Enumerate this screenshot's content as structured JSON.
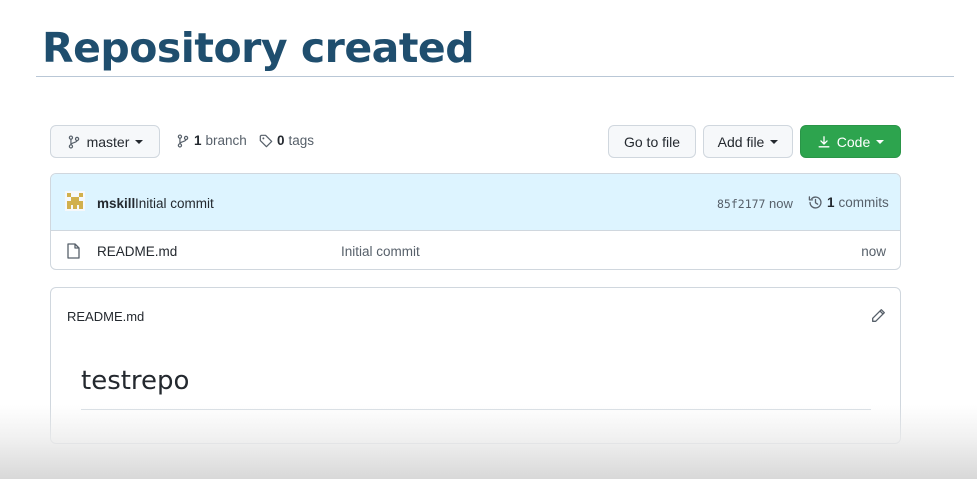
{
  "slide": {
    "title": "Repository created"
  },
  "toolbar": {
    "branch_name": "master",
    "branch_count": "1",
    "branch_label": "branch",
    "tag_count": "0",
    "tag_label": "tags",
    "goto_file_label": "Go to file",
    "add_file_label": "Add file",
    "code_label": "Code",
    "code_button_color": "#2da44e"
  },
  "latest_commit": {
    "author": "mskill",
    "message": "Initial commit",
    "sha": "85f2177",
    "time": "now",
    "commit_count": "1",
    "commit_label": "commits"
  },
  "files": [
    {
      "icon": "file-icon",
      "name": "README.md",
      "last_commit": "Initial commit",
      "age": "now"
    }
  ],
  "readme": {
    "filename": "README.md",
    "heading": "testrepo"
  },
  "colors": {
    "title": "#1f4e6e",
    "commit_row_bg": "#ddf4ff"
  }
}
